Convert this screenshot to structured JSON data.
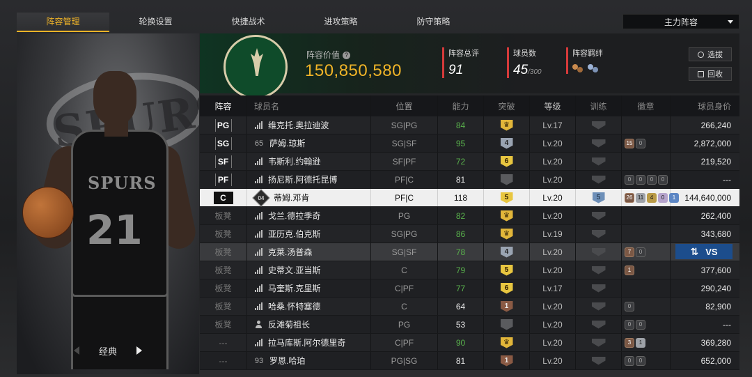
{
  "tabs": [
    "阵容管理",
    "轮换设置",
    "快捷战术",
    "进攻策略",
    "防守策略"
  ],
  "active_tab": 0,
  "lineup_select": "主力阵容",
  "player_art": {
    "team_text": "SPURS",
    "jersey_number": "21",
    "jersey_logo": "SPURS"
  },
  "mode_switch": {
    "label": "经典"
  },
  "info": {
    "value_label": "阵容价值",
    "value": "150,850,580",
    "rating_label": "阵容总评",
    "rating": "91",
    "count_label": "球员数",
    "count": "45",
    "count_max": "/300",
    "bond_label": "阵容羁绊",
    "btn_pick": "选拔",
    "btn_recycle": "回收"
  },
  "table": {
    "headers": {
      "pos": "阵容",
      "name": "球员名",
      "position": "位置",
      "ability": "能力",
      "break": "突破",
      "level": "等级",
      "train": "训练",
      "badge": "徽章",
      "price": "球员身价"
    },
    "rows": [
      {
        "pos": "PG",
        "slot": "starter",
        "icon": "lv",
        "name": "维克托.奥拉迪波",
        "position": "SG|PG",
        "ability": "84",
        "ability_green": true,
        "break": "crown",
        "level": "Lv.17",
        "train": "plain",
        "badges": [],
        "price": "266,240"
      },
      {
        "pos": "SG",
        "slot": "starter",
        "icon": "65",
        "name": "萨姆.琼斯",
        "position": "SG|SF",
        "ability": "95",
        "ability_green": true,
        "break": "4",
        "level": "Lv.20",
        "train": "plain",
        "badges": [
          [
            "15",
            "bronze"
          ],
          [
            "0",
            "gray"
          ]
        ],
        "price": "2,872,000"
      },
      {
        "pos": "SF",
        "slot": "starter",
        "icon": "lv",
        "name": "韦斯利.约翰逊",
        "position": "SF|PF",
        "ability": "72",
        "ability_green": true,
        "break": "6",
        "level": "Lv.20",
        "train": "plain",
        "badges": [],
        "price": "219,520"
      },
      {
        "pos": "PF",
        "slot": "starter",
        "icon": "lv",
        "name": "扬尼斯.阿德托昆博",
        "position": "PF|C",
        "ability": "81",
        "ability_green": false,
        "break": "none",
        "level": "Lv.20",
        "train": "plain",
        "badges": [
          [
            "0",
            "gray"
          ],
          [
            "0",
            "gray"
          ],
          [
            "0",
            "gray"
          ],
          [
            "0",
            "gray"
          ]
        ],
        "price": "---"
      },
      {
        "pos": "C",
        "slot": "selected",
        "icon": "04",
        "name": "蒂姆.邓肯",
        "position": "PF|C",
        "ability": "118",
        "ability_green": false,
        "break": "5",
        "level": "Lv.20",
        "train": "5",
        "badges": [
          [
            "26",
            "bronze"
          ],
          [
            "11",
            "silver"
          ],
          [
            "4",
            "gold"
          ],
          [
            "0",
            "purple"
          ],
          [
            "1",
            "blue"
          ]
        ],
        "price": "144,640,000"
      },
      {
        "pos": "板凳",
        "slot": "bench",
        "icon": "lv",
        "name": "戈兰.德拉季奇",
        "position": "PG",
        "ability": "82",
        "ability_green": true,
        "break": "crown",
        "level": "Lv.20",
        "train": "plain",
        "badges": [],
        "price": "262,400"
      },
      {
        "pos": "板凳",
        "slot": "bench",
        "icon": "lv",
        "name": "亚历克.伯克斯",
        "position": "SG|PG",
        "ability": "86",
        "ability_green": true,
        "break": "crown",
        "level": "Lv.19",
        "train": "plain",
        "badges": [],
        "price": "343,680"
      },
      {
        "pos": "板凳",
        "slot": "hover",
        "icon": "lv",
        "name": "克莱.汤普森",
        "position": "SG|SF",
        "ability": "78",
        "ability_green": true,
        "break": "4",
        "level": "Lv.20",
        "train": "plain",
        "badges": [
          [
            "7",
            "bronze"
          ],
          [
            "0",
            "gray"
          ]
        ],
        "price": "",
        "vs_label": "VS"
      },
      {
        "pos": "板凳",
        "slot": "bench",
        "icon": "lv",
        "name": "史蒂文.亚当斯",
        "position": "C",
        "ability": "79",
        "ability_green": true,
        "break": "5",
        "level": "Lv.20",
        "train": "plain",
        "badges": [
          [
            "1",
            "bronze"
          ]
        ],
        "price": "377,600"
      },
      {
        "pos": "板凳",
        "slot": "bench",
        "icon": "lv",
        "name": "马奎斯.克里斯",
        "position": "C|PF",
        "ability": "77",
        "ability_green": true,
        "break": "6",
        "level": "Lv.17",
        "train": "plain",
        "badges": [],
        "price": "290,240"
      },
      {
        "pos": "板凳",
        "slot": "bench",
        "icon": "lv",
        "name": "哈桑.怀特塞德",
        "position": "C",
        "ability": "64",
        "ability_green": false,
        "break": "1",
        "level": "Lv.20",
        "train": "plain",
        "badges": [
          [
            "0",
            "gray"
          ]
        ],
        "price": "82,900"
      },
      {
        "pos": "板凳",
        "slot": "bench",
        "icon": "person",
        "name": "反滩菊祖长",
        "position": "PG",
        "ability": "53",
        "ability_green": false,
        "break": "none",
        "level": "Lv.20",
        "train": "plain",
        "badges": [
          [
            "0",
            "gray"
          ],
          [
            "0",
            "gray"
          ]
        ],
        "price": "---"
      },
      {
        "pos": "---",
        "slot": "bench",
        "icon": "lv",
        "name": "拉马库斯.阿尔德里奇",
        "position": "C|PF",
        "ability": "90",
        "ability_green": true,
        "break": "crown",
        "level": "Lv.20",
        "train": "plain",
        "badges": [
          [
            "3",
            "bronze"
          ],
          [
            "1",
            "silver"
          ]
        ],
        "price": "369,280"
      },
      {
        "pos": "---",
        "slot": "bench",
        "icon": "93",
        "name": "罗恩.哈珀",
        "position": "PG|SG",
        "ability": "81",
        "ability_green": false,
        "break": "1",
        "level": "Lv.20",
        "train": "plain",
        "badges": [
          [
            "0",
            "gray"
          ],
          [
            "0",
            "gray"
          ]
        ],
        "price": "652,000"
      }
    ]
  }
}
